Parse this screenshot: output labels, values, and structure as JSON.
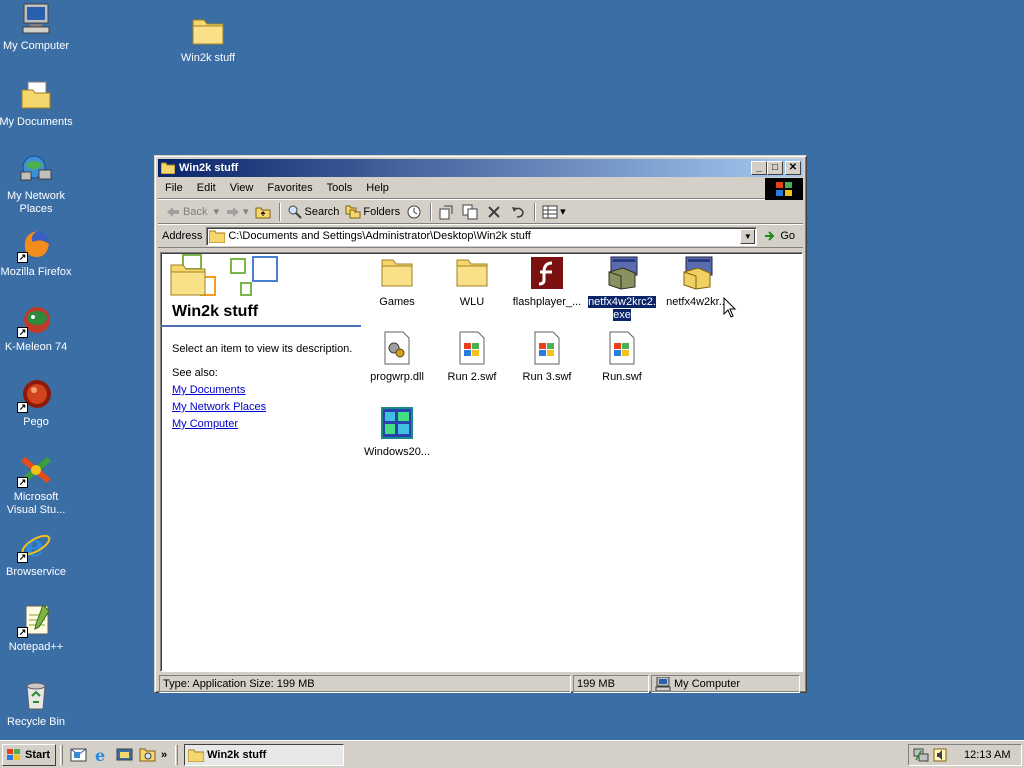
{
  "desktop": {
    "icons": [
      {
        "label": "My Computer",
        "icon": "my-computer-icon"
      },
      {
        "label": "My Documents",
        "icon": "my-documents-icon"
      },
      {
        "label": "My Network Places",
        "icon": "network-places-icon"
      },
      {
        "label": "Mozilla Firefox",
        "icon": "firefox-icon"
      },
      {
        "label": "K-Meleon 74",
        "icon": "k-meleon-icon"
      },
      {
        "label": "Pego",
        "icon": "pego-icon"
      },
      {
        "label": "Microsoft Visual Stu...",
        "icon": "visual-studio-icon"
      },
      {
        "label": "Browservice",
        "icon": "internet-explorer-icon"
      },
      {
        "label": "Notepad++",
        "icon": "notepad-plus-plus-icon"
      },
      {
        "label": "Recycle Bin",
        "icon": "recycle-bin-icon"
      },
      {
        "label": "Win2k stuff",
        "icon": "folder-icon"
      }
    ]
  },
  "window": {
    "title": "Win2k stuff",
    "menu": [
      "File",
      "Edit",
      "View",
      "Favorites",
      "Tools",
      "Help"
    ],
    "toolbar": {
      "back": "Back",
      "search": "Search",
      "folders": "Folders"
    },
    "address": {
      "label": "Address",
      "value": "C:\\Documents and Settings\\Administrator\\Desktop\\Win2k stuff",
      "go": "Go"
    },
    "leftpane": {
      "title": "Win2k stuff",
      "description": "Select an item to view its description.",
      "see_also": "See also:",
      "links": [
        "My Documents",
        "My Network Places",
        "My Computer"
      ]
    },
    "files": [
      {
        "label": "Games",
        "icon": "folder-icon"
      },
      {
        "label": "WLU",
        "icon": "folder-icon"
      },
      {
        "label": "flashplayer_...",
        "icon": "flash-icon"
      },
      {
        "label": "netfx4w2krc2.exe",
        "line1": "netfx4w2krc2.",
        "line2": "exe",
        "icon": "installer-icon",
        "selected": true
      },
      {
        "label": "netfx4w2kr...",
        "icon": "installer-icon"
      },
      {
        "label": "progwrp.dll",
        "icon": "dll-icon"
      },
      {
        "label": "Run 2.swf",
        "icon": "swf-icon"
      },
      {
        "label": "Run 3.swf",
        "icon": "swf-icon"
      },
      {
        "label": "Run.swf",
        "icon": "swf-icon"
      },
      {
        "label": "Windows20...",
        "icon": "windows2000-icon"
      }
    ],
    "status": {
      "type": "Type: Application Size: 199 MB",
      "size": "199 MB",
      "zone": "My Computer"
    }
  },
  "taskbar": {
    "start": "Start",
    "task": "Win2k stuff",
    "chevron": "»",
    "clock": "12:13 AM"
  }
}
